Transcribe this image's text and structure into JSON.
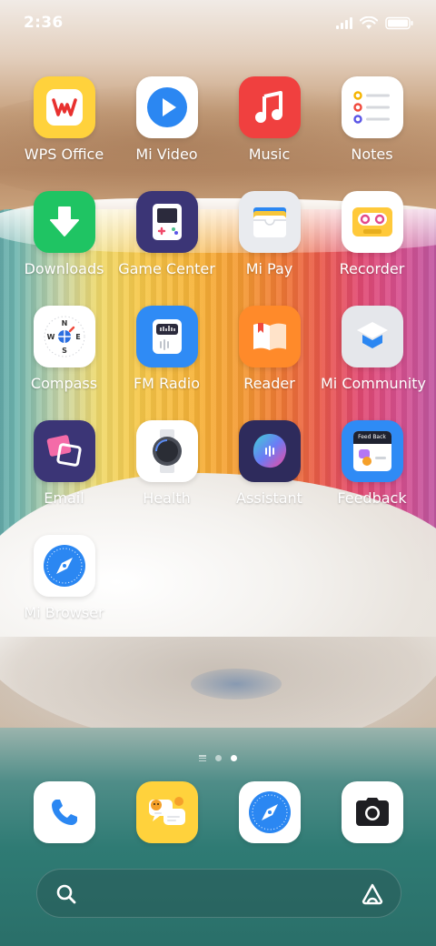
{
  "status_bar": {
    "time": "2:36",
    "battery_icon": "battery-icon",
    "wifi_icon": "wifi-icon",
    "signal_icon": "signal-icon"
  },
  "apps": [
    {
      "label": "WPS Office",
      "icon": "wps-office-icon",
      "color": "#FFD23C"
    },
    {
      "label": "Mi Video",
      "icon": "mi-video-icon",
      "color": "#FFFFFF"
    },
    {
      "label": "Music",
      "icon": "music-icon",
      "color": "#F0403F"
    },
    {
      "label": "Notes",
      "icon": "notes-icon",
      "color": "#FFFFFF"
    },
    {
      "label": "Downloads",
      "icon": "downloads-icon",
      "color": "#1FC463"
    },
    {
      "label": "Game Center",
      "icon": "game-center-icon",
      "color": "#3B3576"
    },
    {
      "label": "Mi Pay",
      "icon": "mi-pay-icon",
      "color": "#E9EBEF"
    },
    {
      "label": "Recorder",
      "icon": "recorder-icon",
      "color": "#FFFFFF"
    },
    {
      "label": "Compass",
      "icon": "compass-icon",
      "color": "#FFFFFF"
    },
    {
      "label": "FM Radio",
      "icon": "fm-radio-icon",
      "color": "#2F8BF5"
    },
    {
      "label": "Reader",
      "icon": "reader-icon",
      "color": "#FF8A2A"
    },
    {
      "label": "Mi Community",
      "icon": "mi-community-icon",
      "color": "#E5E7EB"
    },
    {
      "label": "Email",
      "icon": "email-icon",
      "color": "#3B3576"
    },
    {
      "label": "Health",
      "icon": "health-icon",
      "color": "#FFFFFF"
    },
    {
      "label": "Assistant",
      "icon": "assistant-icon",
      "color": "#2E2B5C"
    },
    {
      "label": "Feedback",
      "icon": "feedback-icon",
      "color": "#2F8BF5",
      "icon_text": "Feed Back"
    },
    {
      "label": "Mi Browser",
      "icon": "mi-browser-icon",
      "color": "#FFFFFF"
    }
  ],
  "dock": [
    {
      "icon": "phone-icon"
    },
    {
      "icon": "messaging-icon"
    },
    {
      "icon": "browser-icon"
    },
    {
      "icon": "camera-icon"
    }
  ],
  "page_indicator": {
    "pages": 2,
    "current": 2
  },
  "search_bar": {
    "search_icon": "search-icon",
    "assistant_icon": "app-vault-icon"
  }
}
